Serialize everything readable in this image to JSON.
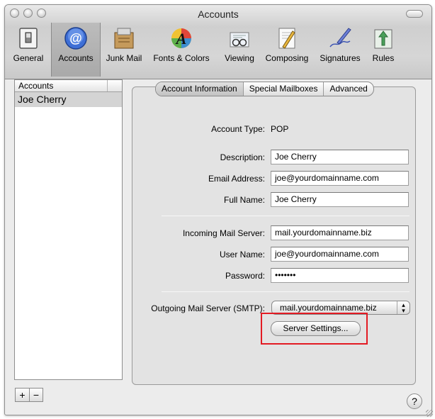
{
  "window": {
    "title": "Accounts"
  },
  "toolbar": {
    "items": [
      {
        "label": "General",
        "icon": "general-switch-icon"
      },
      {
        "label": "Accounts",
        "icon": "at-sign-icon",
        "selected": true
      },
      {
        "label": "Junk Mail",
        "icon": "junk-mail-bin-icon"
      },
      {
        "label": "Fonts & Colors",
        "icon": "fonts-colors-icon"
      },
      {
        "label": "Viewing",
        "icon": "viewing-glasses-icon"
      },
      {
        "label": "Composing",
        "icon": "composing-pencil-icon"
      },
      {
        "label": "Signatures",
        "icon": "signature-pen-icon"
      },
      {
        "label": "Rules",
        "icon": "rules-icon"
      }
    ]
  },
  "sidebar": {
    "header": "Accounts",
    "items": [
      {
        "label": "Joe Cherry",
        "selected": true
      }
    ],
    "add_label": "+",
    "remove_label": "−"
  },
  "tabs": [
    {
      "label": "Account Information",
      "active": true
    },
    {
      "label": "Special Mailboxes"
    },
    {
      "label": "Advanced"
    }
  ],
  "form": {
    "account_type_label": "Account Type:",
    "account_type_value": "POP",
    "description_label": "Description:",
    "description_value": "Joe Cherry",
    "email_label": "Email Address:",
    "email_value": "joe@yourdomainname.com",
    "fullname_label": "Full Name:",
    "fullname_value": "Joe Cherry",
    "incoming_label": "Incoming Mail Server:",
    "incoming_value": "mail.yourdomainname.biz",
    "username_label": "User Name:",
    "username_value": "joe@yourdomainname.com",
    "password_label": "Password:",
    "password_value": "•••••••",
    "smtp_label": "Outgoing Mail Server (SMTP):",
    "smtp_value": "mail.yourdomainname.biz",
    "server_settings_label": "Server Settings..."
  },
  "help_label": "?",
  "colors": {
    "highlight": "#e31b23",
    "selection": "#d4d4d4"
  }
}
